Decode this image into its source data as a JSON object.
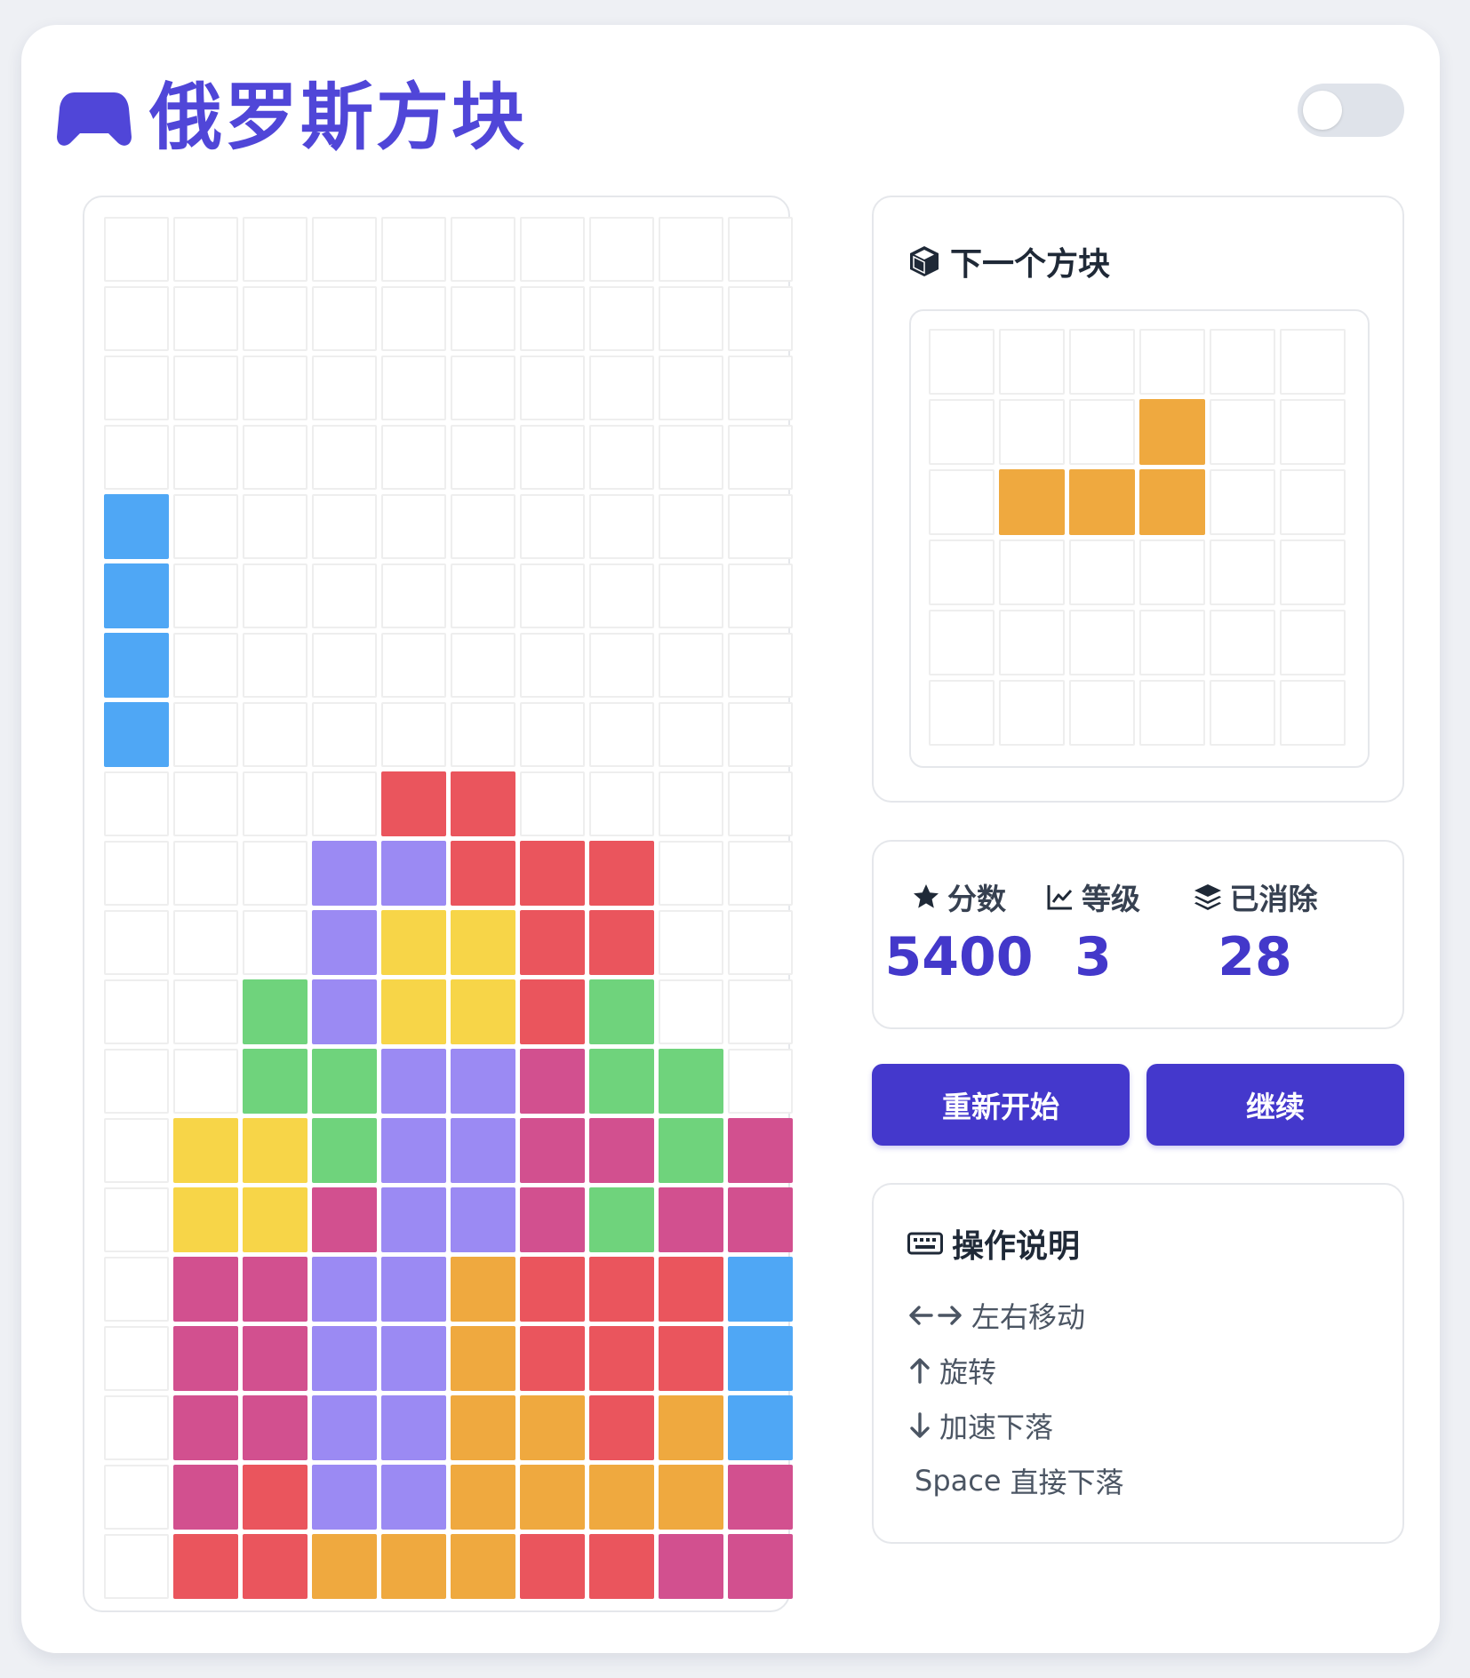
{
  "header": {
    "icon": "gamepad-icon",
    "title": "俄罗斯方块",
    "theme_toggle": {
      "state": "off"
    }
  },
  "colors": {
    "accent": "#5046d8",
    "button": "#4438cc",
    "cyan": "#4fa7f5",
    "red": "#ea555d",
    "purple": "#9b8af3",
    "yellow": "#f7d548",
    "green": "#6fd37c",
    "pink": "#d2508f",
    "orange": "#efa93f"
  },
  "board": {
    "cols": 10,
    "rows": 20,
    "grid": [
      "..........",
      "..........",
      "..........",
      "..........",
      "C.........",
      "C.........",
      "C.........",
      "C.........",
      "....RR....",
      "...PPRRR..",
      "...PYYRR..",
      "..GPYYRG..",
      "..GGPPMGG.",
      ".YYGPPMMGM",
      ".YYMPPMGMM",
      ".MMPPORRRC",
      ".MMPPORRRC",
      ".MMPPOOROC",
      ".MRPPOOOOM",
      ".RROOORRMM"
    ]
  },
  "next_piece": {
    "title": "下一个方块",
    "icon": "cube-icon",
    "cols": 6,
    "rows": 6,
    "grid": [
      "......",
      "...O..",
      ".OOO..",
      "......",
      "......",
      "......"
    ]
  },
  "stats": {
    "score_label": "分数",
    "score_icon": "star-icon",
    "score": "5400",
    "level_label": "等级",
    "level_icon": "chart-line-icon",
    "level": "3",
    "lines_label": "已消除",
    "lines_icon": "layers-icon",
    "lines": "28"
  },
  "buttons": {
    "restart": "重新开始",
    "resume": "继续"
  },
  "help": {
    "title": "操作说明",
    "icon": "keyboard-icon",
    "move": "左右移动",
    "rotate": "旋转",
    "soft_drop": "加速下落",
    "hard_drop_key": "Space",
    "hard_drop": "直接下落"
  }
}
